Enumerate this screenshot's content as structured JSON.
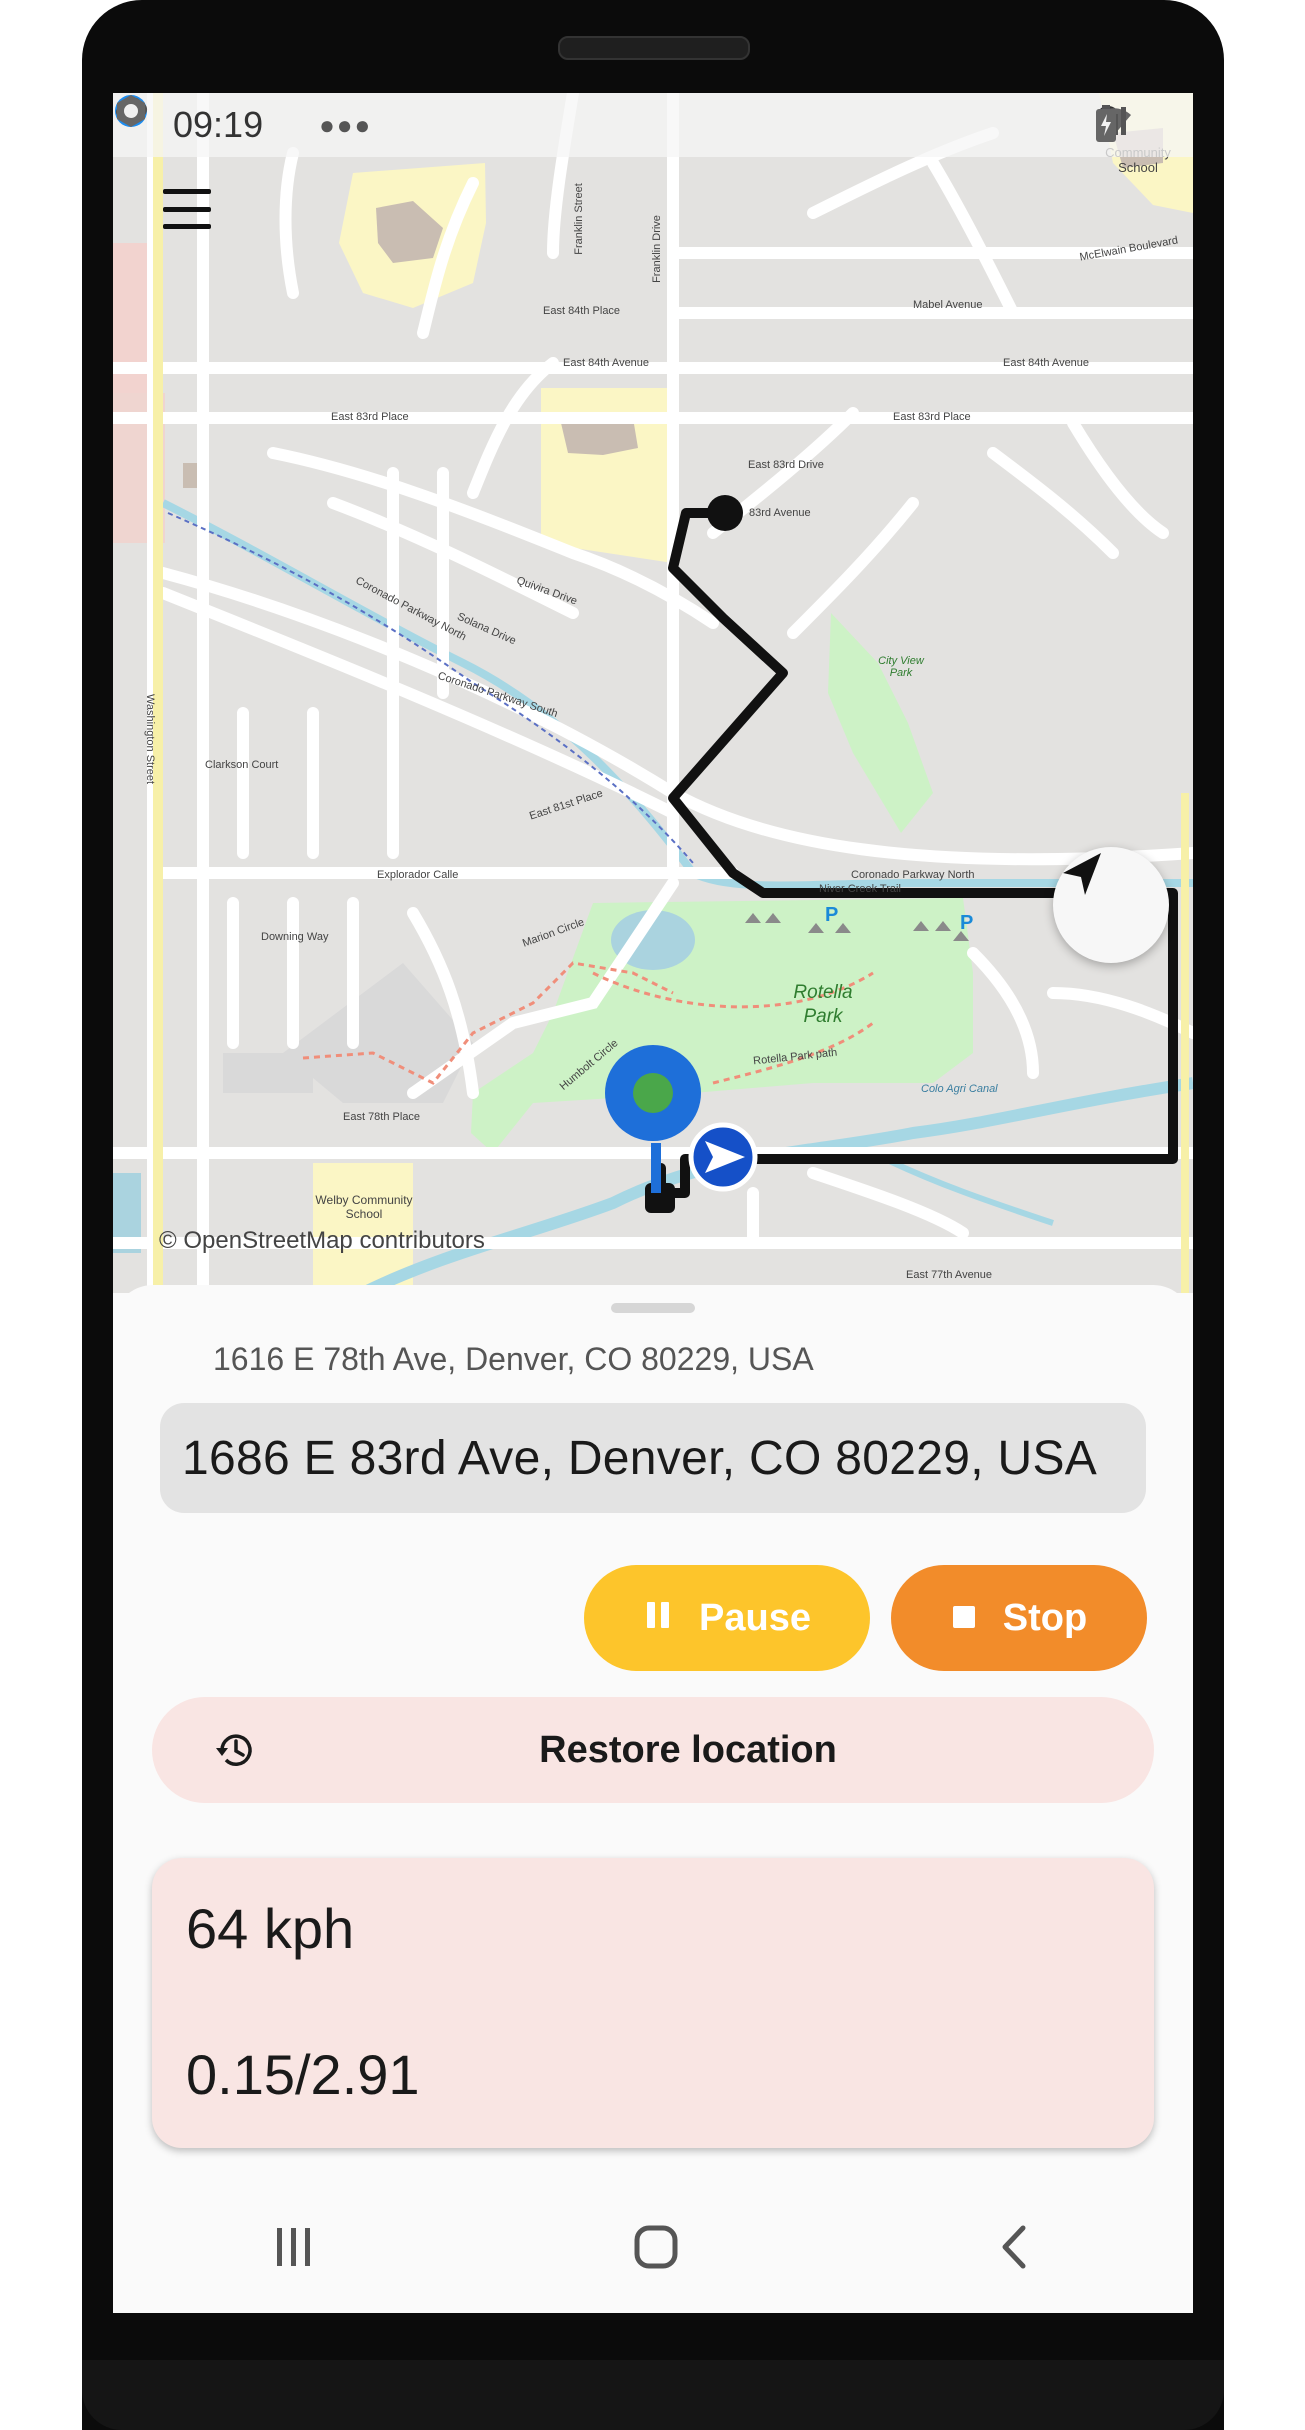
{
  "status_bar": {
    "time": "09:19",
    "left_icons": [
      "safari-compass-icon",
      "cloud-icon",
      "app-shield-icon",
      "more-dots-icon"
    ],
    "right_icons": [
      "location-icon",
      "wifi-icon",
      "signal-icon",
      "battery-charging-icon"
    ]
  },
  "map": {
    "attribution": "© OpenStreetMap contributors",
    "labels": {
      "park": "Rotella Park",
      "park_line2": "Park",
      "park_path": "Rotella Park path",
      "school_south": "Welby Community School",
      "school_north": "Community School",
      "city_view_park": "City View Park",
      "e_84th_ave": "East 84th Avenue",
      "e_84th_place": "East 84th Place",
      "e_83rd_place": "East 83rd Place",
      "e_83rd_drive": "East 83rd Drive",
      "e_83rd_ave": "83rd Avenue",
      "e_81st_place": "East 81st Place",
      "e_78th_place": "East 78th Place",
      "e_77th_ave": "East 77th Avenue",
      "mabel_ave": "Mabel Avenue",
      "mcelwain_blvd": "McElwain Boulevard",
      "coronado_pkwy_n": "Coronado Parkway North",
      "coronado_pkwy_s": "Coronado Parkway South",
      "niver_creek_trail": "Niver Creek Trail",
      "explorador_calle": "Explorador Calle",
      "clarkson_court": "Clarkson Court",
      "downing_way": "Downing Way",
      "marion_circle": "Marion Circle",
      "humbolt_circle": "Humbolt Circle",
      "washington_street": "Washington Street",
      "quivira_drive": "Quivira Drive",
      "solana_drive": "Solana Drive",
      "franklin_street": "Franklin Street",
      "franklin_drive": "Franklin Drive",
      "colo_agri_canal": "Colo Agri Canal"
    }
  },
  "sheet": {
    "from_address": "1616 E 78th Ave, Denver, CO 80229, USA",
    "to_address": "1686 E 83rd Ave, Denver, CO 80229, USA",
    "pause_label": "Pause",
    "stop_label": "Stop",
    "restore_label": "Restore location",
    "speed": "64 kph",
    "progress": "0.15/2.91"
  },
  "colors": {
    "pause": "#fdc52b",
    "stop": "#f28c2a",
    "restore_bg": "#f9e5e3",
    "route": "#111111",
    "current_marker": "#1e6fd9",
    "nav_arrow": "#1550c8"
  },
  "navbar": {
    "icons": [
      "recent-apps-icon",
      "home-icon",
      "back-icon"
    ]
  }
}
